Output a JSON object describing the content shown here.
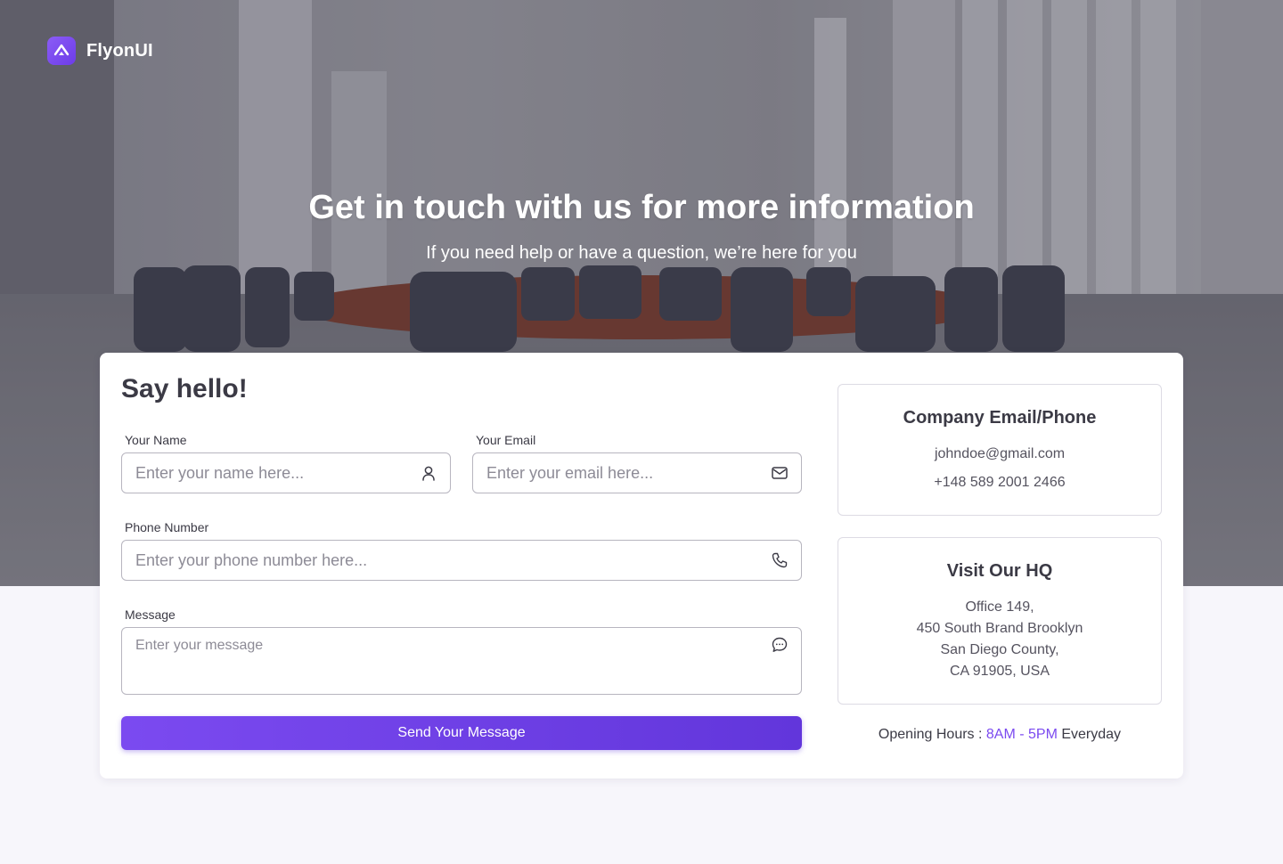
{
  "brand": {
    "name": "FlyonUI"
  },
  "hero": {
    "title": "Get in touch with us for more information",
    "subtitle": "If you need help or have a question, we’re here for you"
  },
  "form": {
    "title": "Say hello!",
    "name": {
      "label": "Your Name",
      "placeholder": "Enter your name here...",
      "value": "",
      "icon": "user-icon"
    },
    "email": {
      "label": "Your Email",
      "placeholder": "Enter your email here...",
      "value": "",
      "icon": "mail-icon"
    },
    "phone": {
      "label": "Phone Number",
      "placeholder": "Enter your phone number here...",
      "value": "",
      "icon": "phone-icon"
    },
    "message": {
      "label": "Message",
      "placeholder": "Enter your message",
      "value": "",
      "icon": "chat-bubble-icon"
    },
    "submit_label": "Send Your Message"
  },
  "contact": {
    "title": "Company Email/Phone",
    "email": "johndoe@gmail.com",
    "phone": "+148 589 2001 2466"
  },
  "hq": {
    "title": "Visit Our HQ",
    "address_lines": [
      "Office 149,",
      "450 South Brand Brooklyn",
      "San Diego County,",
      "CA 91905, USA"
    ]
  },
  "hours": {
    "label": "Opening Hours :",
    "range": "8AM - 5PM",
    "days": "Everyday"
  },
  "colors": {
    "accent": "#7b4af0",
    "page_bg": "#f7f6fb",
    "text": "#3b3a45"
  }
}
